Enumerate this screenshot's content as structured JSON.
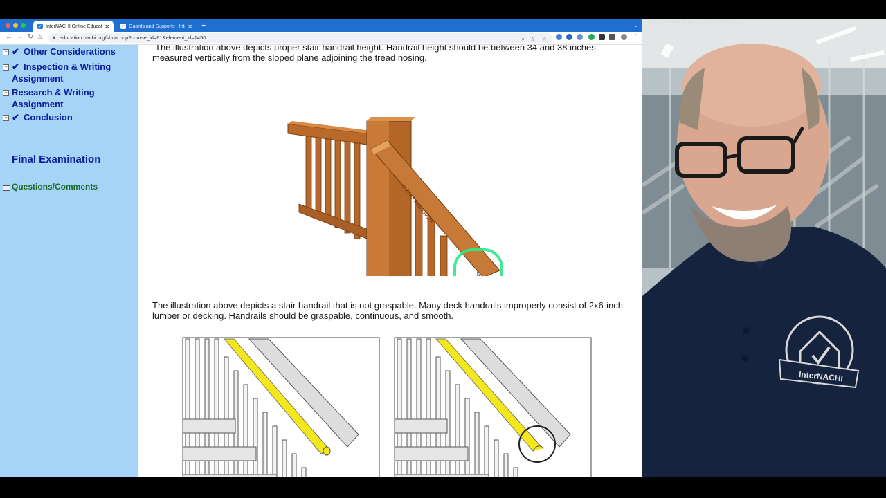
{
  "browser": {
    "tabs": [
      {
        "title": "InterNACHI Online Education",
        "active": true
      },
      {
        "title": "Guards and Supports - InterNACHI",
        "active": false
      }
    ],
    "url": "education.nachi.org/show.php?course_id=61&element_id=1450"
  },
  "sidebar": {
    "items": [
      {
        "label": "Other Considerations",
        "label2": ""
      },
      {
        "label": "Inspection & Writing",
        "label2": "Assignment"
      },
      {
        "label": "Research & Writing",
        "label2": "Assignment"
      },
      {
        "label": "Conclusion",
        "label2": ""
      }
    ],
    "final_exam": "Final Examination",
    "questions": "Questions/Comments"
  },
  "content": {
    "para1": "The illustration above depicts proper stair handrail height. Handrail height should be between 34 and 38 inches measured vertically from the sloped plane adjoining the tread nosing.",
    "para2": "The illustration above depicts a stair handrail that is not graspable. Many deck handrails improperly consist of 2x6-inch lumber or decking.  Handrails should be graspable, continuous, and smooth.",
    "image_watermark": "© 2009 InterNACHI"
  },
  "webcam": {
    "title": "Quick Camera: [C922 Pro Stream Webcam]",
    "shirt_logo_text": "InterNACHI"
  },
  "colors": {
    "sidebar_bg": "#a6d4f7",
    "sidebar_link": "#0b1d9c",
    "questions_link": "#1e6a2c",
    "tabbar": "#1f6fd1",
    "highlight_ring": "#2ee88a",
    "handrail_yellow": "#f4e81c"
  }
}
